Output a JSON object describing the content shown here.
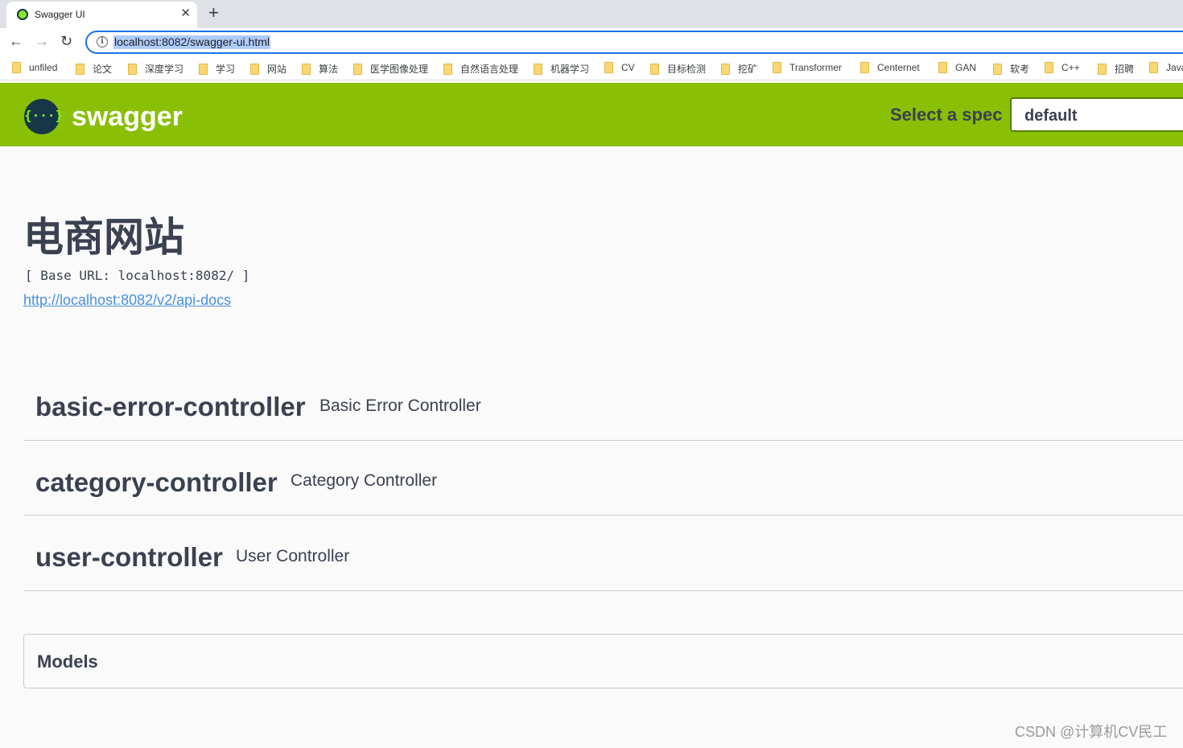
{
  "browser": {
    "tab_title": "Swagger UI",
    "tab_close": "✕",
    "new_tab": "+",
    "back": "←",
    "forward": "→",
    "reload": "↻",
    "info": "i",
    "url": "localhost:8082/swagger-ui.html"
  },
  "bookmarks": [
    "unfiled",
    "论文",
    "深度学习",
    "学习",
    "网站",
    "算法",
    "医学图像处理",
    "自然语言处理",
    "机器学习",
    "CV",
    "目标检测",
    "挖矿",
    "Transformer",
    "Centernet",
    "GAN",
    "软考",
    "C++",
    "招聘",
    "Java"
  ],
  "topbar": {
    "logo_glyph": "{···}",
    "brand": "swagger",
    "select_label": "Select a spec",
    "selected_spec": "default",
    "color": "#89bf04"
  },
  "info": {
    "title": "电商网站",
    "base_url": "[ Base URL: localhost:8082/ ]",
    "api_docs_link": "http://localhost:8082/v2/api-docs"
  },
  "controllers": [
    {
      "name": "basic-error-controller",
      "description": "Basic Error Controller"
    },
    {
      "name": "category-controller",
      "description": "Category Controller"
    },
    {
      "name": "user-controller",
      "description": "User Controller"
    }
  ],
  "models": {
    "title": "Models"
  },
  "watermark": "CSDN @计算机CV民工"
}
